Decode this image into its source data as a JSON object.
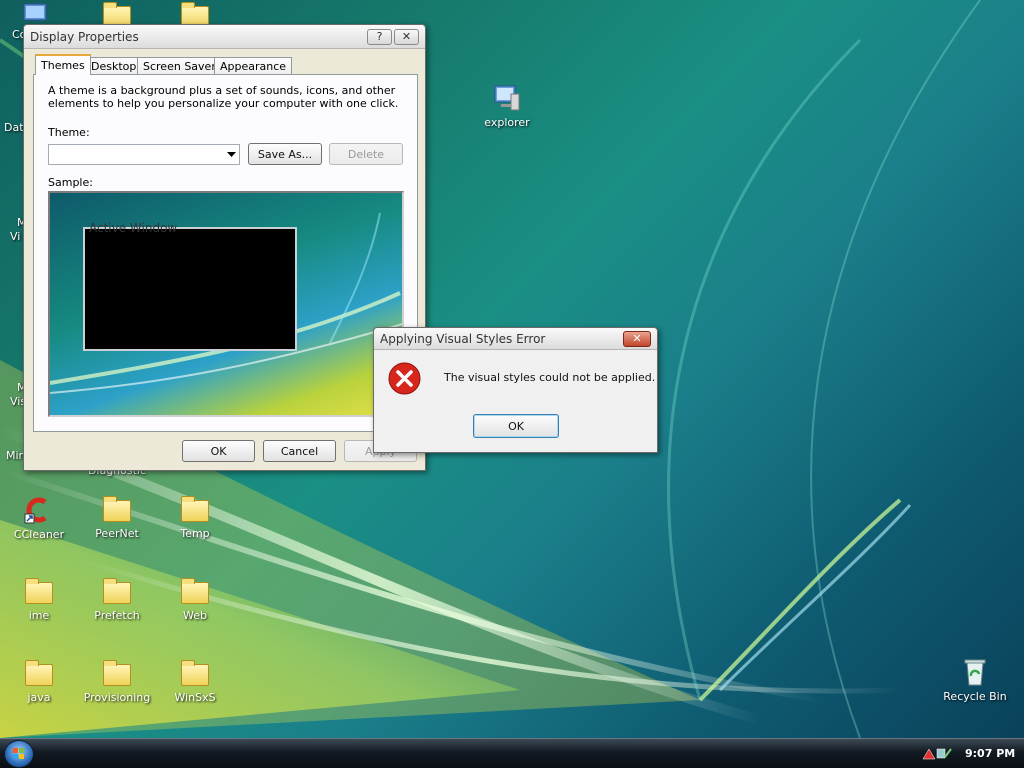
{
  "desktop": {
    "icons_left_partial": [
      {
        "label": "Co"
      },
      {
        "label": "Dat"
      },
      {
        "label": "M\nVi"
      },
      {
        "label": "M\nVis"
      },
      {
        "label": "Min"
      }
    ],
    "partial_label_diagnostic": "Diagnostic",
    "explorer": "explorer",
    "icons": [
      {
        "label": "CCleaner",
        "kind": "app"
      },
      {
        "label": "PeerNet",
        "kind": "folder"
      },
      {
        "label": "Temp",
        "kind": "folder"
      },
      {
        "label": "ime",
        "kind": "folder"
      },
      {
        "label": "Prefetch",
        "kind": "folder"
      },
      {
        "label": "Web",
        "kind": "folder"
      },
      {
        "label": "java",
        "kind": "folder"
      },
      {
        "label": "Provisioning",
        "kind": "folder"
      },
      {
        "label": "WinSxS",
        "kind": "folder"
      }
    ],
    "recycle_bin": "Recycle Bin"
  },
  "display_properties": {
    "title": "Display Properties",
    "help_btn": "?",
    "close_btn": "✕",
    "tabs": [
      "Themes",
      "Desktop",
      "Screen Saver",
      "Appearance"
    ],
    "active_tab": "Themes",
    "description": "A theme is a background plus a set of sounds, icons, and other elements to help you personalize your computer with one click.",
    "theme_label": "Theme:",
    "theme_value": "",
    "save_as": "Save As...",
    "delete": "Delete",
    "sample_label": "Sample:",
    "sample_window_title": "Active Window",
    "ok": "OK",
    "cancel": "Cancel",
    "apply": "Apply"
  },
  "error_dialog": {
    "title": "Applying Visual Styles Error",
    "close_btn": "✕",
    "message": "The visual styles could not be applied.",
    "ok": "OK"
  },
  "taskbar": {
    "clock": "9:07 PM"
  }
}
